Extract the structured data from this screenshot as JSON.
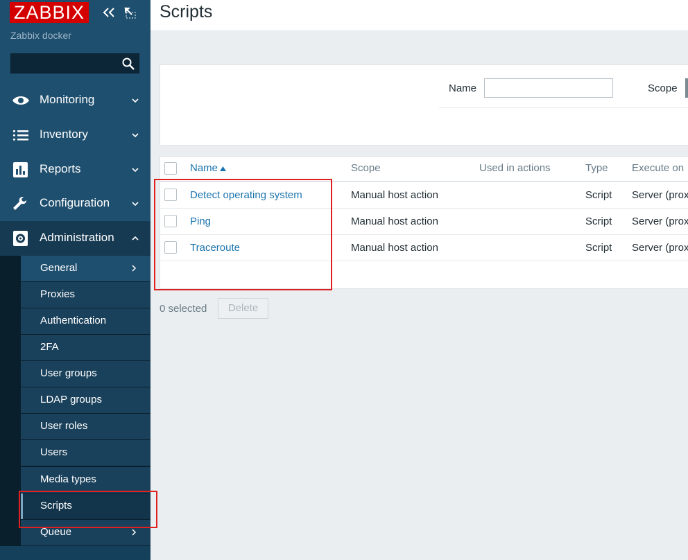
{
  "app": {
    "logo_text": "ZABBIX",
    "server_name": "Zabbix docker",
    "colors": {
      "brand": "#d40000",
      "sidebar": "#1f4f6e",
      "link": "#1a73ad",
      "highlight": "#e02020"
    }
  },
  "search": {
    "placeholder": "",
    "icon": "search-icon"
  },
  "menu": [
    {
      "label": "Monitoring",
      "icon": "eye-icon",
      "expanded": false
    },
    {
      "label": "Inventory",
      "icon": "list-icon",
      "expanded": false
    },
    {
      "label": "Reports",
      "icon": "bar-chart-icon",
      "expanded": false
    },
    {
      "label": "Configuration",
      "icon": "wrench-icon",
      "expanded": false
    },
    {
      "label": "Administration",
      "icon": "gear-icon",
      "expanded": true
    }
  ],
  "submenu": [
    {
      "label": "General",
      "has_children": true
    },
    {
      "label": "Proxies"
    },
    {
      "label": "Authentication"
    },
    {
      "label": "2FA"
    },
    {
      "label": "User groups"
    },
    {
      "label": "LDAP groups"
    },
    {
      "label": "User roles"
    },
    {
      "label": "Users"
    },
    {
      "label": "Media types"
    },
    {
      "label": "Scripts",
      "selected": true
    },
    {
      "label": "Queue",
      "has_children": true
    }
  ],
  "page": {
    "title": "Scripts"
  },
  "filter": {
    "name_label": "Name",
    "name_value": "",
    "scope_label": "Scope"
  },
  "table": {
    "columns": [
      "Name",
      "Scope",
      "Used in actions",
      "Type",
      "Execute on"
    ],
    "sort_column": "Name",
    "rows": [
      {
        "name": "Detect operating system",
        "scope": "Manual host action",
        "used_in_actions": "",
        "type": "Script",
        "execute_on": "Server (prox"
      },
      {
        "name": "Ping",
        "scope": "Manual host action",
        "used_in_actions": "",
        "type": "Script",
        "execute_on": "Server (prox"
      },
      {
        "name": "Traceroute",
        "scope": "Manual host action",
        "used_in_actions": "",
        "type": "Script",
        "execute_on": "Server (prox"
      }
    ]
  },
  "footer": {
    "selected_text": "0 selected",
    "delete_label": "Delete"
  }
}
